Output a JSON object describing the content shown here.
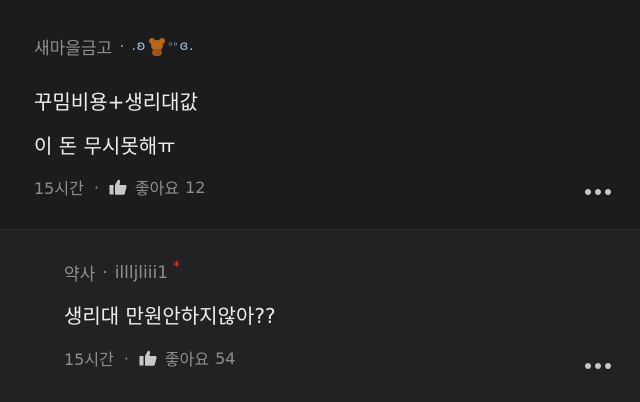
{
  "comments": [
    {
      "author": "새마을금고",
      "separator": "·",
      "author_decoration": ".ʚ  ɞ.",
      "decoration_icon": "teddy-bear-icon",
      "lines": [
        "꾸밈비용+생리대값",
        "이 돈 무시못해ㅠ"
      ],
      "time": "15시간",
      "like_label": "좋아요",
      "like_count": "12"
    },
    {
      "author": "약사",
      "separator": "·",
      "author_id": "illljliii1",
      "badge": "*",
      "lines": [
        "생리대 만원안하지않아??"
      ],
      "time": "15시간",
      "like_label": "좋아요",
      "like_count": "54"
    }
  ],
  "icons": {
    "like": "thumbs-up-icon",
    "more": "more-dots-icon"
  },
  "colors": {
    "background": "#1c1c1e",
    "reply_background": "#222224",
    "muted": "#8e8e93",
    "badge": "#e0413a"
  }
}
